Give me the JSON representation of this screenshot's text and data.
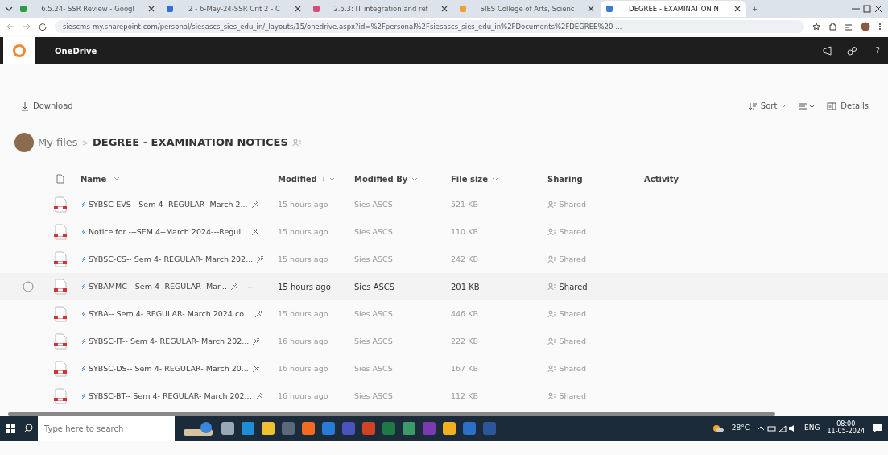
{
  "browser": {
    "tabs": [
      {
        "title": "6.5.24- SSR Review - Googl",
        "selected": false
      },
      {
        "title": "2 - 6-May-24-SSR Crit 2 - C",
        "selected": false
      },
      {
        "title": "2.5.3: IT integration and ref",
        "selected": false
      },
      {
        "title": "SIES College of Arts, Scienc",
        "selected": false
      },
      {
        "title": "DEGREE - EXAMINATION N",
        "selected": true
      }
    ],
    "new_tab": "+",
    "address": "siescms-my.sharepoint.com/personal/siesascs_sies_edu_in/_layouts/15/onedrive.aspx?id=%2Fpersonal%2Fsiesascs_sies_edu_in%2FDocuments%2FDEGREE%20-..."
  },
  "app": {
    "title": "OneDrive",
    "help": "?"
  },
  "commands": {
    "download": "Download",
    "sort": "Sort",
    "details": "Details"
  },
  "breadcrumb": {
    "root": "My files",
    "separator": ">",
    "current": "DEGREE - EXAMINATION NOTICES"
  },
  "table": {
    "columns": [
      "Name",
      "Modified",
      "Modified By",
      "File size",
      "Sharing",
      "Activity"
    ],
    "rows": [
      {
        "name": "SYBSC-EVS -  Sem 4- REGULAR- March 2...",
        "modified": "15 hours ago",
        "modified_by": "Sies ASCS",
        "size": "521 KB",
        "sharing": "Shared",
        "hovered": false
      },
      {
        "name": "Notice for ---SEM 4--March 2024---Regul...",
        "modified": "15 hours ago",
        "modified_by": "Sies ASCS",
        "size": "110 KB",
        "sharing": "Shared",
        "hovered": false
      },
      {
        "name": "SYBSC-CS-- Sem 4- REGULAR- March 202...",
        "modified": "15 hours ago",
        "modified_by": "Sies ASCS",
        "size": "242 KB",
        "sharing": "Shared",
        "hovered": false
      },
      {
        "name": "SYBAMMC-- Sem 4- REGULAR- Mar...",
        "modified": "15 hours ago",
        "modified_by": "Sies ASCS",
        "size": "201 KB",
        "sharing": "Shared",
        "hovered": true,
        "more": "···"
      },
      {
        "name": "SYBA-- Sem 4- REGULAR- March 2024 co...",
        "modified": "15 hours ago",
        "modified_by": "Sies ASCS",
        "size": "446 KB",
        "sharing": "Shared",
        "hovered": false
      },
      {
        "name": "SYBSC-IT-- Sem 4- REGULAR- March 202...",
        "modified": "16 hours ago",
        "modified_by": "Sies ASCS",
        "size": "222 KB",
        "sharing": "Shared",
        "hovered": false
      },
      {
        "name": "SYBSC-DS-- Sem 4- REGULAR- March 20...",
        "modified": "16 hours ago",
        "modified_by": "Sies ASCS",
        "size": "167 KB",
        "sharing": "Shared",
        "hovered": false
      },
      {
        "name": "SYBSC-BT-- Sem 4- REGULAR- March 202...",
        "modified": "16 hours ago",
        "modified_by": "Sies ASCS",
        "size": "112 KB",
        "sharing": "Shared",
        "hovered": false
      }
    ]
  },
  "taskbar": {
    "search_placeholder": "Type here to search",
    "weather": "28°C",
    "language": "ENG",
    "time": "08:00",
    "date": "11-05-2024"
  }
}
